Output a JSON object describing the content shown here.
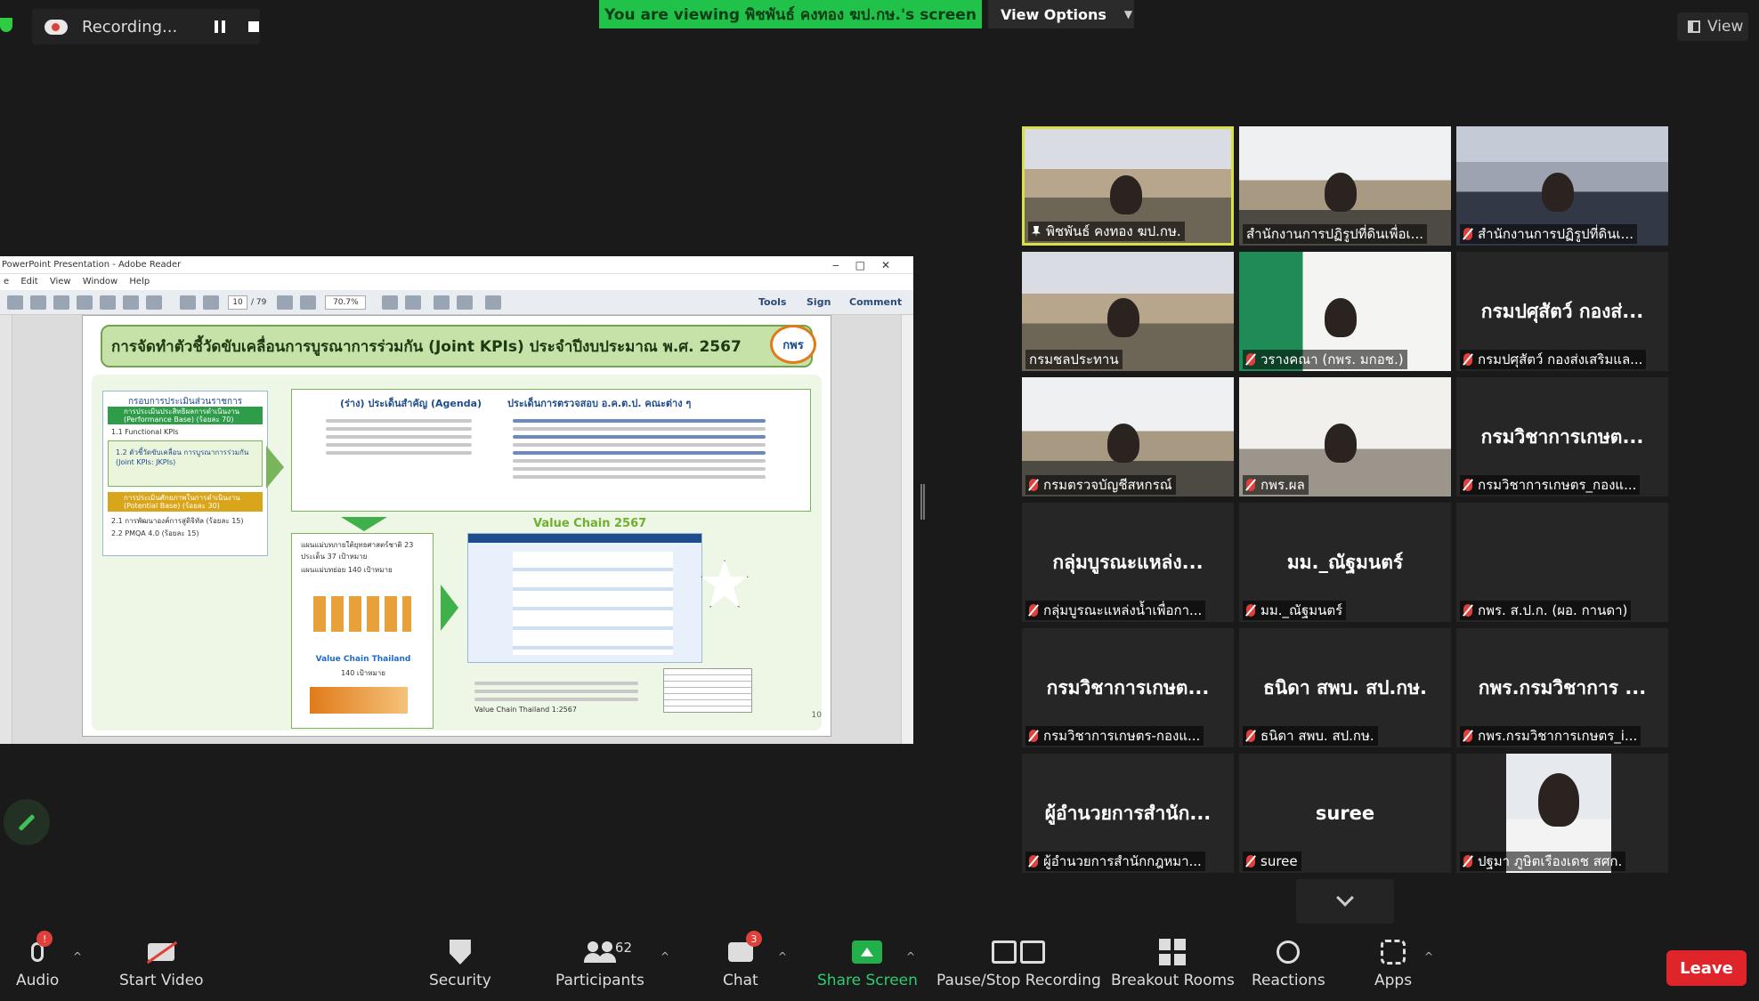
{
  "recording": {
    "label": "Recording..."
  },
  "banner": {
    "viewing_text": "You are viewing พิชพันธ์ คงทอง ฆป.กษ.'s screen",
    "view_options": "View Options"
  },
  "view_button": {
    "label": "View"
  },
  "shared_window": {
    "title": "PowerPoint Presentation - Adobe Reader",
    "menu": "e  Edit  View  Window  Help",
    "page_current": "10",
    "page_total": "/ 79",
    "zoom": "70.7%",
    "tools_label": "Tools",
    "sign_label": "Sign",
    "comment_label": "Comment"
  },
  "slide": {
    "title": "การจัดทำตัวชี้วัดขับเคลื่อนการบูรณาการร่วมกัน (Joint KPIs) ประจำปีงบประมาณ พ.ศ. 2567",
    "logo": "กพร",
    "left_header": "กรอบการประเมินส่วนราชการ",
    "item1": "การประเมินประสิทธิผลการดำเนินงาน (Performance Base) (ร้อยละ 70)",
    "item1_1": "1.1 Functional KPIs",
    "item1_2": "1.2 ตัวชี้วัดขับเคลื่อน การบูรณาการร่วมกัน (Joint KPIs: JKPIs)",
    "item2": "การประเมินศักยภาพในการดำเนินงาน (Potential Base) (ร้อยละ 30)",
    "item2_1": "2.1 การพัฒนาองค์การสู่ดิจิทัล (ร้อยละ 15)",
    "item2_2": "2.2 PMQA 4.0 (ร้อยละ 15)",
    "agenda_title": "(ร่าง) ประเด็นสำคัญ (Agenda)",
    "audit_title": "ประเด็นการตรวจสอบ อ.ค.ต.ป. คณะต่าง ๆ",
    "value_chain_title": "Value Chain 2567",
    "vc_thailand": "Value Chain Thailand",
    "vc_thailand_sub": "140 เป้าหมาย",
    "plan_line1": "แผนแม่บทภายใต้ยุทธศาสตร์ชาติ 23 ประเด็น 37 เป้าหมาย",
    "plan_line2": "แผนแม่บทย่อย 140 เป้าหมาย",
    "bottom_note": "Value Chain Thailand 1:2567",
    "page_number": "10"
  },
  "gallery": [
    {
      "big": "",
      "tag": "พิชพันธ์ คงทอง ฆป.กษ.",
      "pinned": true,
      "muted": false,
      "bg": "room"
    },
    {
      "big": "",
      "tag": "สำนักงานการปฏิรูปที่ดินเพื่อเ...",
      "pinned": false,
      "muted": false,
      "bg": "room2"
    },
    {
      "big": "",
      "tag": "สำนักงานการปฏิรูปที่ดินเ...",
      "pinned": false,
      "muted": true,
      "bg": "room3"
    },
    {
      "big": "",
      "tag": "กรมชลประทาน",
      "pinned": false,
      "muted": false,
      "bg": "room"
    },
    {
      "big": "",
      "tag": "วรางคณา (กพร. มกอช.)",
      "pinned": false,
      "muted": true,
      "bg": "room4"
    },
    {
      "big": "กรมปศุสัตว์ กองส่...",
      "tag": "กรมปศุสัตว์ กองส่งเสริมแล...",
      "pinned": false,
      "muted": true,
      "bg": ""
    },
    {
      "big": "",
      "tag": "กรมตรวจบัญชีสหกรณ์",
      "pinned": false,
      "muted": true,
      "bg": "room2"
    },
    {
      "big": "",
      "tag": "กพร.ผล",
      "pinned": false,
      "muted": true,
      "bg": "room5"
    },
    {
      "big": "กรมวิชาการเกษต...",
      "tag": "กรมวิชาการเกษตร_กองแ...",
      "pinned": false,
      "muted": true,
      "bg": ""
    },
    {
      "big": "กลุ่มบูรณะแหล่ง...",
      "tag": "กลุ่มบูรณะแหล่งน้ำเพื่อกา...",
      "pinned": false,
      "muted": true,
      "bg": ""
    },
    {
      "big": "มม._ณัฐมนตร์",
      "tag": "มม._ณัฐมนตร์",
      "pinned": false,
      "muted": true,
      "bg": ""
    },
    {
      "big": "",
      "tag": "กพร. ส.ป.ก. (ผอ. กานดา)",
      "pinned": false,
      "muted": true,
      "bg": ""
    },
    {
      "big": "กรมวิชาการเกษต...",
      "tag": "กรมวิชาการเกษตร-กองแ...",
      "pinned": false,
      "muted": true,
      "bg": ""
    },
    {
      "big": "ธนิดา สพบ. สป.กษ.",
      "tag": "ธนิดา สพบ. สป.กษ.",
      "pinned": false,
      "muted": true,
      "bg": ""
    },
    {
      "big": "กพร.กรมวิชาการ ...",
      "tag": "กพร.กรมวิชาการเกษตร_i...",
      "pinned": false,
      "muted": true,
      "bg": ""
    },
    {
      "big": "ผู้อำนวยการสำนัก...",
      "tag": "ผู้อำนวยการสำนักกฎหมา...",
      "pinned": false,
      "muted": true,
      "bg": ""
    },
    {
      "big": "suree",
      "tag": "suree",
      "pinned": false,
      "muted": true,
      "bg": ""
    },
    {
      "big": "",
      "tag": "ปฐมา ภูษิตเรืองเดช สศก.",
      "pinned": false,
      "muted": true,
      "bg": "avatar"
    }
  ],
  "toolbar": {
    "audio": "Audio",
    "audio_badge": "!",
    "video": "Start Video",
    "security": "Security",
    "participants": "Participants",
    "participants_count": "62",
    "chat": "Chat",
    "chat_badge": "3",
    "share": "Share Screen",
    "record": "Pause/Stop Recording",
    "breakout": "Breakout Rooms",
    "reactions": "Reactions",
    "apps": "Apps",
    "leave": "Leave"
  },
  "colors": {
    "accent_green": "#21c24a",
    "leave_red": "#e0252a",
    "active_border": "#d9e14a"
  }
}
